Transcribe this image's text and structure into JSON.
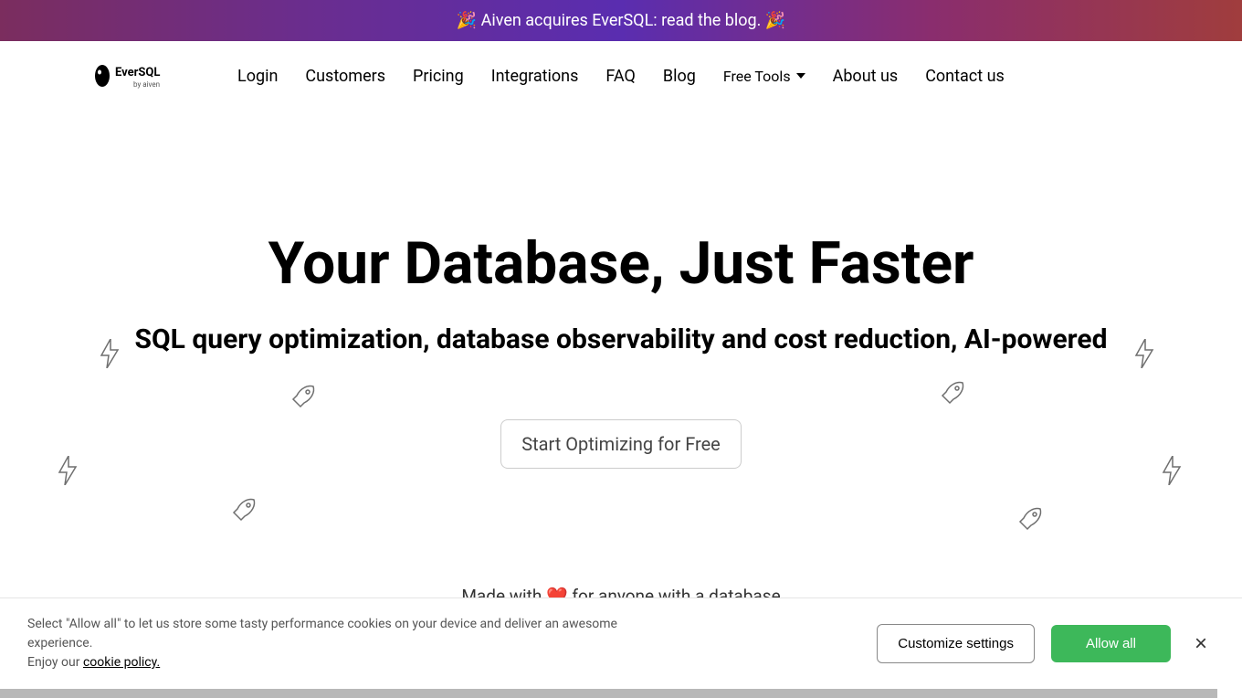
{
  "banner": {
    "text": "🎉 Aiven acquires EverSQL: read the blog. 🎉"
  },
  "nav": {
    "logo_alt": "EverSQL by aiven",
    "items": [
      {
        "label": "Login"
      },
      {
        "label": "Customers"
      },
      {
        "label": "Pricing"
      },
      {
        "label": "Integrations"
      },
      {
        "label": "FAQ"
      },
      {
        "label": "Blog"
      },
      {
        "label": "Free Tools",
        "dropdown": true
      },
      {
        "label": "About us"
      },
      {
        "label": "Contact us"
      }
    ]
  },
  "hero": {
    "title": "Your Database, Just Faster",
    "subtitle": "SQL query optimization, database observability and cost reduction, AI-powered",
    "cta_label": "Start Optimizing for Free",
    "tagline": "Made with ❤️  for anyone with a database"
  },
  "cookies": {
    "text_line1": "Select \"Allow all\" to let us store some tasty performance cookies on your device and deliver an awesome experience.",
    "text_line2_prefix": "Enjoy our ",
    "policy_link": "cookie policy.",
    "customize_label": "Customize settings",
    "allow_label": "Allow all",
    "close_label": "×"
  },
  "colors": {
    "primary_green": "#3db85a",
    "banner_grad_start": "#7b2d5e",
    "banner_grad_end": "#a03d3d"
  }
}
